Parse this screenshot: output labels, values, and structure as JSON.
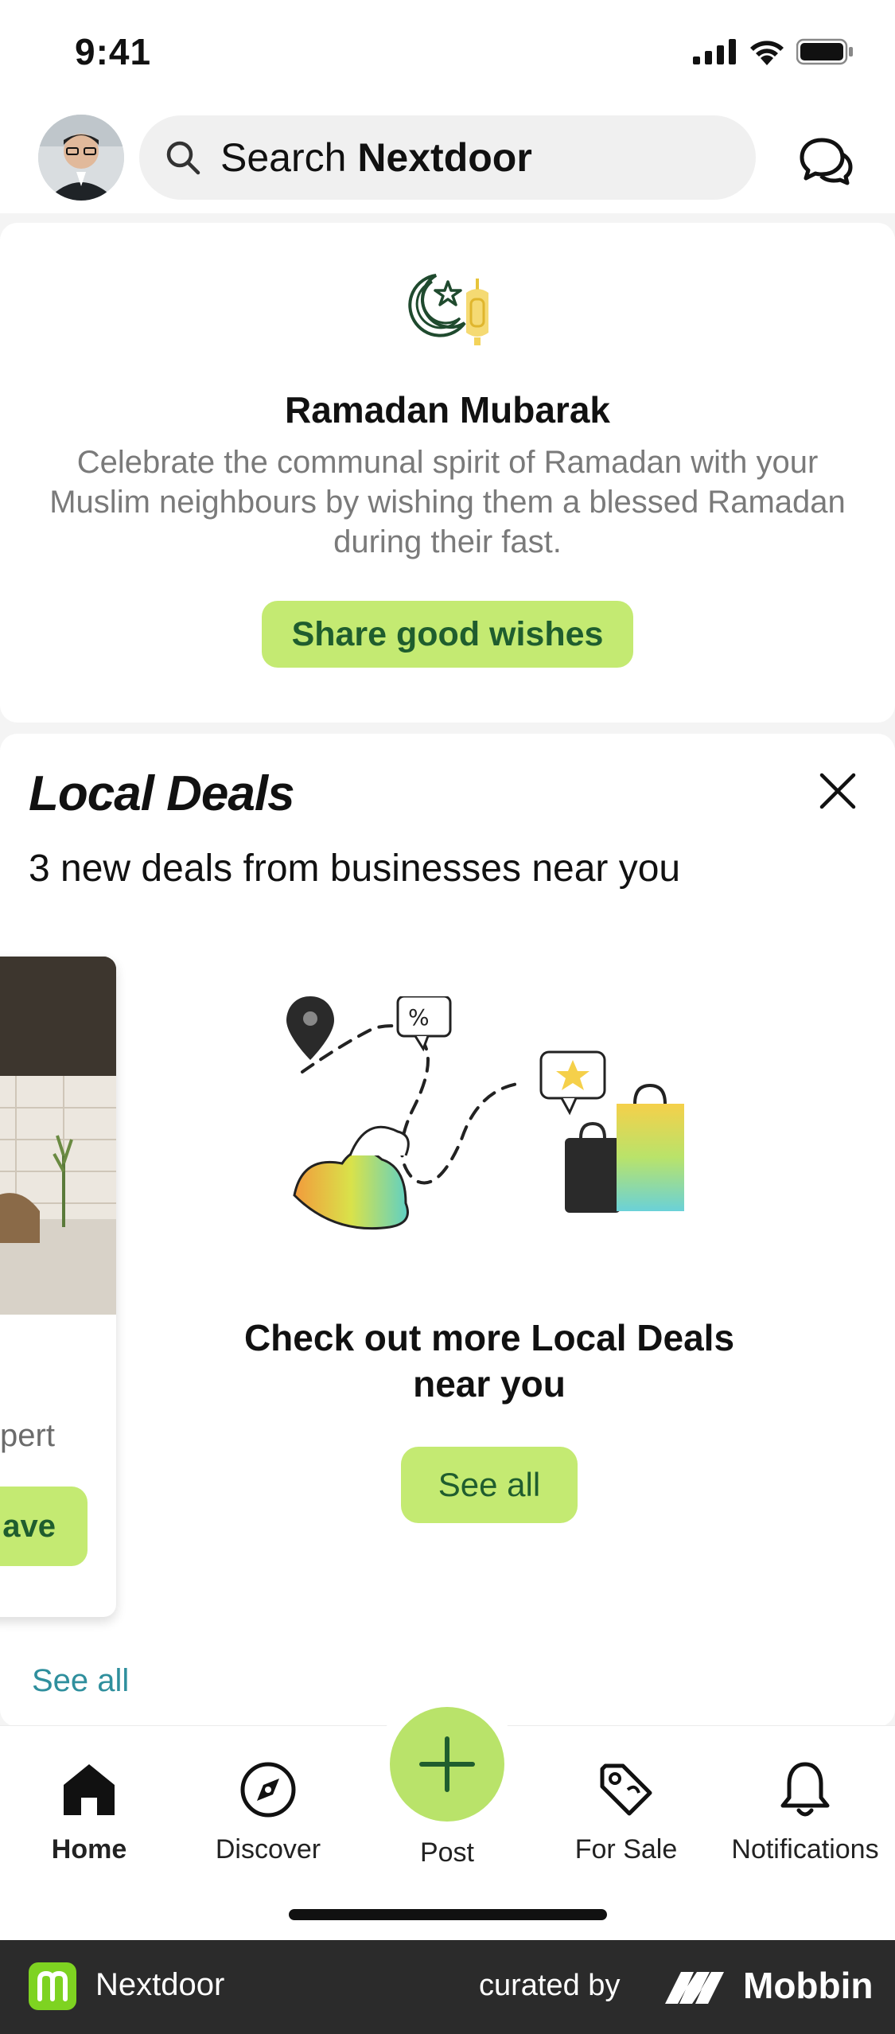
{
  "status_bar": {
    "time": "9:41"
  },
  "header": {
    "search_placeholder_prefix": "Search ",
    "search_placeholder_brand": "Nextdoor"
  },
  "ramadan_card": {
    "title": "Ramadan Mubarak",
    "description": "Celebrate the communal spirit of Ramadan with your Muslim neighbours by wishing them a blessed Ramadan during their fast.",
    "cta": "Share good wishes"
  },
  "local_deals": {
    "title": "Local Deals",
    "subtitle": "3 new deals from businesses near you",
    "peek_card": {
      "text": "xpert",
      "button": "ave"
    },
    "more_text": "Check out more Local Deals near you",
    "see_all_button": "See all",
    "see_all_link": "See all"
  },
  "bottom_nav": {
    "items": [
      {
        "label": "Home",
        "icon": "home-icon",
        "active": true
      },
      {
        "label": "Discover",
        "icon": "compass-icon",
        "active": false
      },
      {
        "label": "Post",
        "icon": "plus-icon",
        "active": false
      },
      {
        "label": "For Sale",
        "icon": "tag-icon",
        "active": false
      },
      {
        "label": "Notifications",
        "icon": "bell-icon",
        "active": false
      }
    ]
  },
  "footer": {
    "app_name": "Nextdoor",
    "curated_by": "curated by",
    "brand": "Mobbin"
  },
  "colors": {
    "accent_green": "#c4ea72",
    "accent_text": "#1f5d2e",
    "link_teal": "#2f8f9d"
  }
}
